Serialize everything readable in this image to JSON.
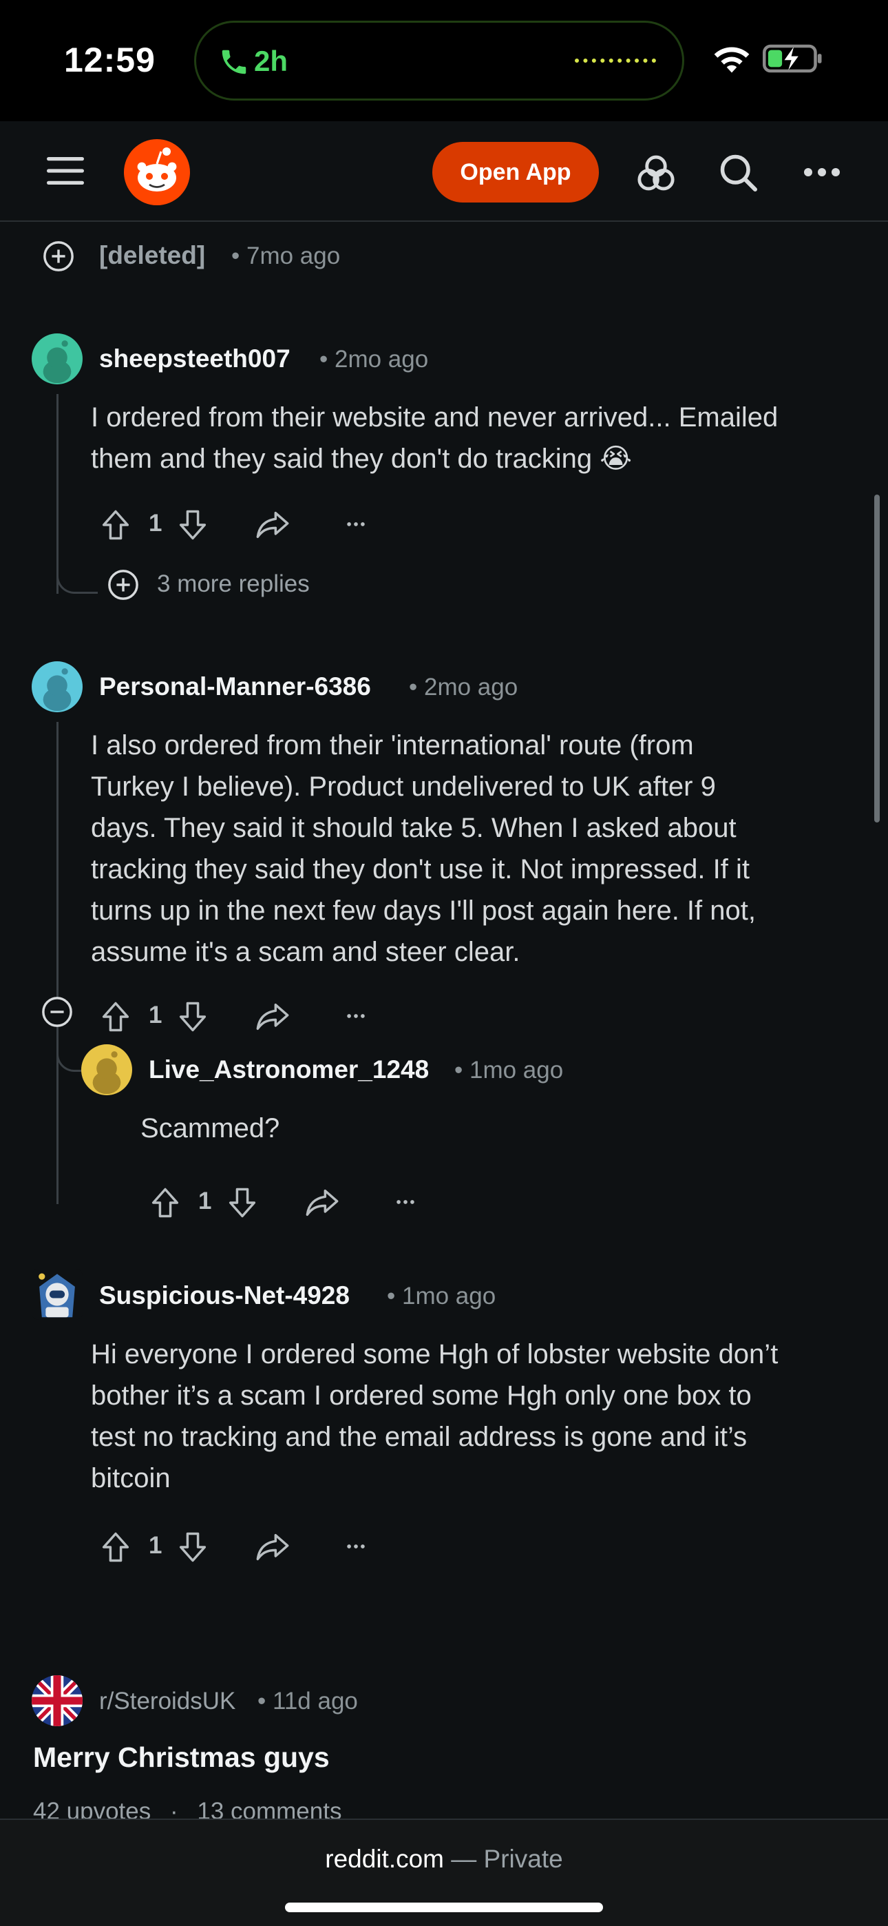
{
  "status": {
    "time": "12:59",
    "call_duration": "2h"
  },
  "nav": {
    "open_app_label": "Open App"
  },
  "comments": {
    "deleted": {
      "user": "[deleted]",
      "age": "• 7mo ago"
    },
    "c1": {
      "user": "sheepsteeth007",
      "age": "• 2mo ago",
      "text_line1": "I ordered from their website and never arrived... Emailed",
      "text_line2": "them and they said they don't do tracking 😭",
      "votes": "1",
      "more_replies": "3 more replies"
    },
    "c2": {
      "user": "Personal-Manner-6386",
      "age": "• 2mo ago",
      "lines": [
        "I also ordered from their 'international' route (from",
        "Turkey I believe). Product undelivered to UK after 9",
        "days. They said it should take 5. When I asked about",
        "tracking they said they don't use it. Not impressed. If it",
        "turns up in the next few days I'll post again here. If not,",
        "assume it's a scam and steer clear."
      ],
      "votes": "1"
    },
    "c3": {
      "user": "Live_Astronomer_1248",
      "age": "• 1mo ago",
      "text": "Scammed?",
      "votes": "1"
    },
    "c4": {
      "user": "Suspicious-Net-4928",
      "age": "• 1mo ago",
      "lines": [
        "Hi everyone I ordered some Hgh of lobster website don’t",
        "bother it’s a scam I ordered some Hgh only one box to",
        "test no tracking and the email address is gone and it’s",
        "bitcoin"
      ],
      "votes": "1"
    }
  },
  "related_post": {
    "subreddit": "r/SteroidsUK",
    "age": "• 11d ago",
    "title": "Merry Christmas guys",
    "upvotes": "42 upvotes",
    "separator": "·",
    "comments": "13 comments"
  },
  "footer": {
    "domain": "reddit.com",
    "suffix": " — Private"
  },
  "colors": {
    "background": "#0e1113",
    "accent": "#d93a00",
    "call_green": "#4cd964"
  }
}
